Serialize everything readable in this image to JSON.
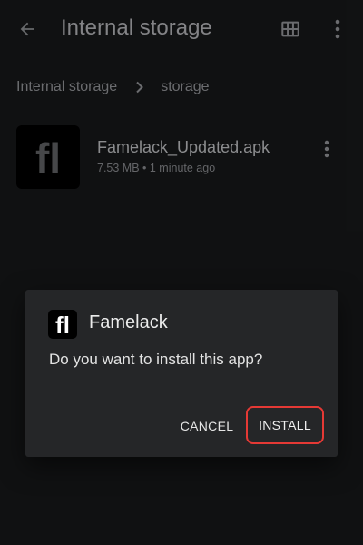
{
  "toolbar": {
    "back_icon": "arrow-back-icon",
    "title": "Internal storage",
    "grid_icon": "grid-view-icon",
    "more_icon": "more-vert-icon"
  },
  "breadcrumb": {
    "items": [
      "Internal storage",
      "storage"
    ],
    "separator_icon": "chevron-right-icon"
  },
  "file": {
    "name": "Famelack_Updated.apk",
    "meta": "7.53 MB • 1 minute ago",
    "thumb_text": "fl",
    "more_icon": "more-vert-icon"
  },
  "dialog": {
    "app_icon_text": "fl",
    "app_name": "Famelack",
    "message": "Do you want to install this app?",
    "cancel_label": "CANCEL",
    "install_label": "INSTALL",
    "highlight_color": "#e53935"
  },
  "colors": {
    "background": "#1a1b1d",
    "dialog_background": "#252628",
    "highlight": "#e53935"
  }
}
